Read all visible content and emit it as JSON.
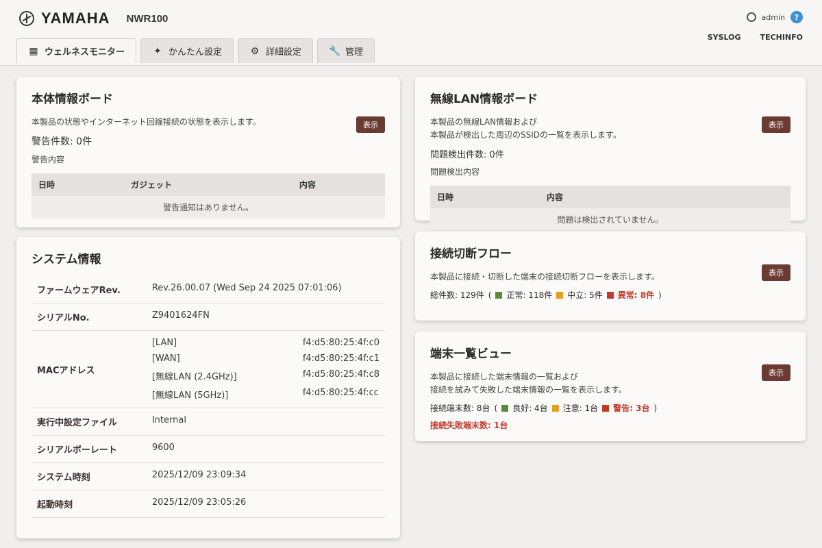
{
  "header": {
    "brand": "YAMAHA",
    "model": "NWR100",
    "user": "admin",
    "help": "?",
    "links": [
      "SYSLOG",
      "TECHINFO"
    ],
    "tabs": [
      {
        "label": "ウェルネスモニター",
        "icon": "monitor-icon",
        "active": true
      },
      {
        "label": "かんたん設定",
        "icon": "wand-icon",
        "active": false
      },
      {
        "label": "詳細設定",
        "icon": "gear-icon",
        "active": false
      },
      {
        "label": "管理",
        "icon": "wrench-icon",
        "active": false
      }
    ]
  },
  "status_board": {
    "title": "本体情報ボード",
    "description": "本製品の状態やインターネット回線接続の状態を表示します。",
    "show_button": "表示",
    "warning_count": "警告件数: 0件",
    "warning_label": "警告内容",
    "columns": [
      "日時",
      "ガジェット",
      "内容"
    ],
    "empty_message": "警告通知はありません。"
  },
  "wlan_board": {
    "title": "無線LAN情報ボード",
    "description_1": "本製品の無線LAN情報および",
    "description_2": "本製品が検出した周辺のSSIDの一覧を表示します。",
    "show_button": "表示",
    "problem_count": "問題検出件数: 0件",
    "problem_label": "問題検出内容",
    "columns": [
      "日時",
      "内容"
    ],
    "empty_message": "問題は検出されていません。"
  },
  "system_info": {
    "title": "システム情報",
    "firmware_label": "ファームウェアRev.",
    "firmware_value": "Rev.26.00.07 (Wed Sep 24 2025 07:01:06)",
    "serial_label": "シリアルNo.",
    "serial_value": "Z9401624FN",
    "mac_label": "MACアドレス",
    "mac_rows": [
      {
        "name": "[LAN]",
        "addr": "f4:d5:80:25:4f:c0"
      },
      {
        "name": "[WAN]",
        "addr": "f4:d5:80:25:4f:c1"
      },
      {
        "name": "[無線LAN (2.4GHz)]",
        "addr": "f4:d5:80:25:4f:c8"
      },
      {
        "name": "[無線LAN (5GHz)]",
        "addr": "f4:d5:80:25:4f:cc"
      }
    ],
    "config_label": "実行中設定ファイル",
    "config_value": "Internal",
    "baud_label": "シリアルボーレート",
    "baud_value": "9600",
    "time_label": "システム時刻",
    "time_value": "2025/12/09 23:09:34",
    "boot_label": "起動時刻",
    "boot_value": "2025/12/09 23:05:26"
  },
  "flow_board": {
    "title": "接続切断フロー",
    "description": "本製品に接続・切断した端末の接続切断フローを表示します。",
    "show_button": "表示",
    "total": "総件数: 129件",
    "items": [
      {
        "label": "正常: 118件",
        "color": "#5a8a3a"
      },
      {
        "label": "中立: 5件",
        "color": "#e0a020"
      },
      {
        "label": "異常: 8件",
        "color": "#c0392b"
      }
    ]
  },
  "terminal_board": {
    "title": "端末一覧ビュー",
    "description_1": "本製品に接続した端末情報の一覧および",
    "description_2": "接続を試みて失敗した端末情報の一覧を表示します。",
    "show_button": "表示",
    "total": "接続端末数: 8台",
    "items": [
      {
        "label": "良好: 4台",
        "color": "#5a8a3a"
      },
      {
        "label": "注意: 1台",
        "color": "#e0a020"
      },
      {
        "label": "警告: 3台",
        "color": "#c0392b"
      }
    ],
    "failed": "接続失敗端末数: 1台"
  }
}
